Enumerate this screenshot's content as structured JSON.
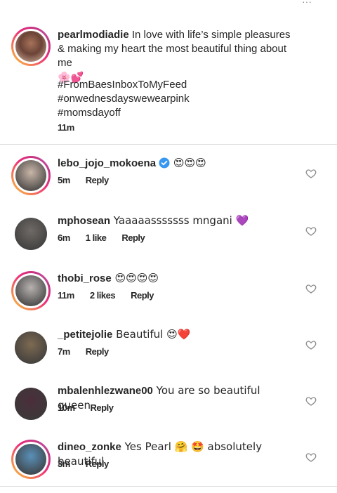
{
  "caption": {
    "username": "pearlmodiadie",
    "text": "In love with life’s simple pleasures & making my heart the most beautiful thing about me",
    "emoji_line": "🌸💕",
    "hashtags": [
      "#FromBaesInboxToMyFeed",
      "#onwednesdayswewearpink",
      "#momsdayoff"
    ],
    "time": "11m"
  },
  "comments": [
    {
      "username": "lebo_jojo_mokoena",
      "verified": true,
      "text": "😍😍😍",
      "time": "5m",
      "likes": "",
      "reply": "Reply",
      "story": true,
      "avatar_color": "#c9b6a8"
    },
    {
      "username": "mphosean",
      "verified": false,
      "text": "Yaaaaasssssss mngani 💜",
      "time": "6m",
      "likes": "1 like",
      "reply": "Reply",
      "story": false,
      "avatar_color": "#6f6a66"
    },
    {
      "username": "thobi_rose",
      "verified": false,
      "text": "😍😍😍😍",
      "time": "11m",
      "likes": "2 likes",
      "reply": "Reply",
      "story": true,
      "avatar_color": "#b7b2b0"
    },
    {
      "username": "_petitejolie",
      "verified": false,
      "text": "Beautiful 😍❤️",
      "time": "7m",
      "likes": "",
      "reply": "Reply",
      "story": false,
      "avatar_color": "#7d6a52"
    },
    {
      "username": "mbalenhlezwane00",
      "verified": false,
      "text": "You are so beautiful queen",
      "time": "10m",
      "likes": "",
      "reply": "Reply",
      "story": false,
      "avatar_color": "#4b2e3a"
    },
    {
      "username": "dineo_zonke",
      "verified": false,
      "text": "Yes Pearl 🤗 🤩 absolutely beautiful",
      "time": "3m",
      "likes": "",
      "reply": "Reply",
      "story": true,
      "avatar_color": "#5a90b8"
    }
  ]
}
